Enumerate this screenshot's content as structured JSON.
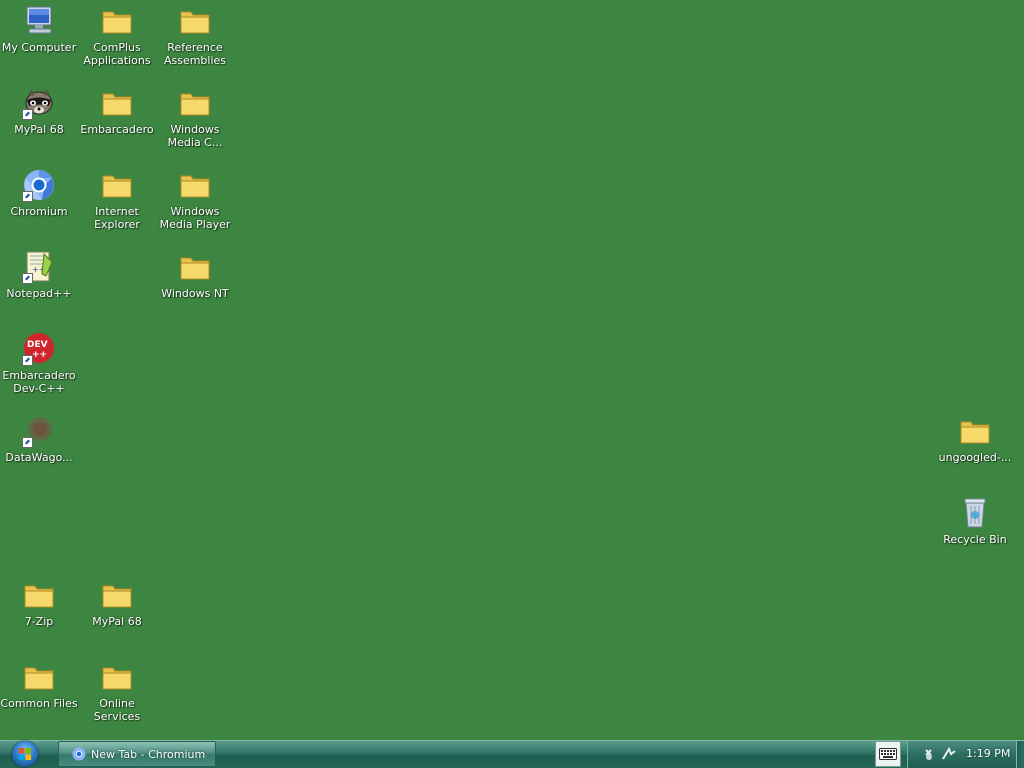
{
  "desktop": {
    "background_color": "#3d8641",
    "icons": {
      "my_computer": {
        "label": "My Computer",
        "icon": "computer-icon"
      },
      "complus": {
        "label": "ComPlus\nApplications",
        "icon": "folder-icon"
      },
      "reference": {
        "label": "Reference\nAssemblies",
        "icon": "folder-icon"
      },
      "mypal_shortcut": {
        "label": "MyPal 68",
        "icon": "raccoon-icon"
      },
      "embarcadero": {
        "label": "Embarcadero",
        "icon": "folder-icon"
      },
      "wmc": {
        "label": "Windows\nMedia C...",
        "icon": "folder-icon"
      },
      "chromium": {
        "label": "Chromium",
        "icon": "chromium-icon"
      },
      "ie": {
        "label": "Internet\nExplorer",
        "icon": "folder-icon"
      },
      "wmp": {
        "label": "Windows\nMedia Player",
        "icon": "folder-icon"
      },
      "notepadpp": {
        "label": "Notepad++",
        "icon": "notepadpp-icon"
      },
      "winnt": {
        "label": "Windows NT",
        "icon": "folder-icon"
      },
      "devcpp": {
        "label": "Embarcadero\nDev-C++",
        "icon": "devcpp-icon"
      },
      "datawago": {
        "label": "DataWago...",
        "icon": "datawago-icon"
      },
      "sevenzip": {
        "label": "7-Zip",
        "icon": "folder-icon"
      },
      "mypal_folder": {
        "label": "MyPal 68",
        "icon": "folder-icon"
      },
      "common_files": {
        "label": "Common Files",
        "icon": "folder-icon"
      },
      "online_services": {
        "label": "Online\nServices",
        "icon": "folder-icon"
      },
      "ungoogled": {
        "label": "ungoogled-...",
        "icon": "folder-icon"
      },
      "recycle_bin": {
        "label": "Recycle Bin",
        "icon": "recycle-bin-icon"
      }
    }
  },
  "taskbar": {
    "start_icon": "windows-orb-icon",
    "active_window": {
      "label": "New Tab - Chromium",
      "icon": "chromium-icon"
    },
    "tray": {
      "keyboard_icon": "keyboard-icon",
      "network_icon": "network-icon",
      "clock": "1:19 PM"
    }
  }
}
